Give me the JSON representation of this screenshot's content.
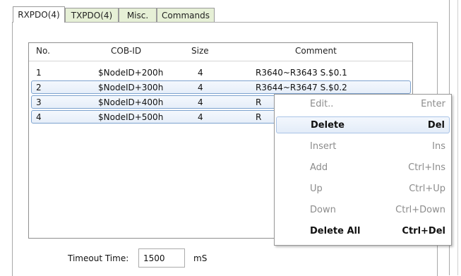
{
  "tabs": [
    {
      "label": "RXPDO(4)",
      "active": true
    },
    {
      "label": "TXPDO(4)",
      "active": false
    },
    {
      "label": "Misc.",
      "active": false
    },
    {
      "label": "Commands",
      "active": false
    }
  ],
  "table": {
    "columns": [
      "No.",
      "COB-ID",
      "Size",
      "Comment"
    ],
    "rows": [
      {
        "no": "1",
        "cob_id": "$NodeID+200h",
        "size": "4",
        "comment": "R3640~R3643 S.$0.1"
      },
      {
        "no": "2",
        "cob_id": "$NodeID+300h",
        "size": "4",
        "comment": "R3644~R3647 S.$0.2"
      },
      {
        "no": "3",
        "cob_id": "$NodeID+400h",
        "size": "4",
        "comment": "R"
      },
      {
        "no": "4",
        "cob_id": "$NodeID+500h",
        "size": "4",
        "comment": "R"
      }
    ]
  },
  "context_menu": [
    {
      "label": "Edit..",
      "shortcut": "Enter",
      "enabled": false,
      "bold": false
    },
    {
      "label": "Delete",
      "shortcut": "Del",
      "enabled": true,
      "bold": true
    },
    {
      "label": "Insert",
      "shortcut": "Ins",
      "enabled": false,
      "bold": false
    },
    {
      "label": "Add",
      "shortcut": "Ctrl+Ins",
      "enabled": false,
      "bold": false
    },
    {
      "label": "Up",
      "shortcut": "Ctrl+Up",
      "enabled": false,
      "bold": false
    },
    {
      "label": "Down",
      "shortcut": "Ctrl+Down",
      "enabled": false,
      "bold": false
    },
    {
      "label": "Delete All",
      "shortcut": "Ctrl+Del",
      "enabled": true,
      "bold": true
    }
  ],
  "footer": {
    "timeout_label": "Timeout Time:",
    "timeout_value": "1500",
    "timeout_unit": "mS"
  },
  "colors": {
    "inactive_tab": "#e6f0d6",
    "selection_border": "#7da2ce",
    "disabled_text": "#8c8c8c"
  }
}
